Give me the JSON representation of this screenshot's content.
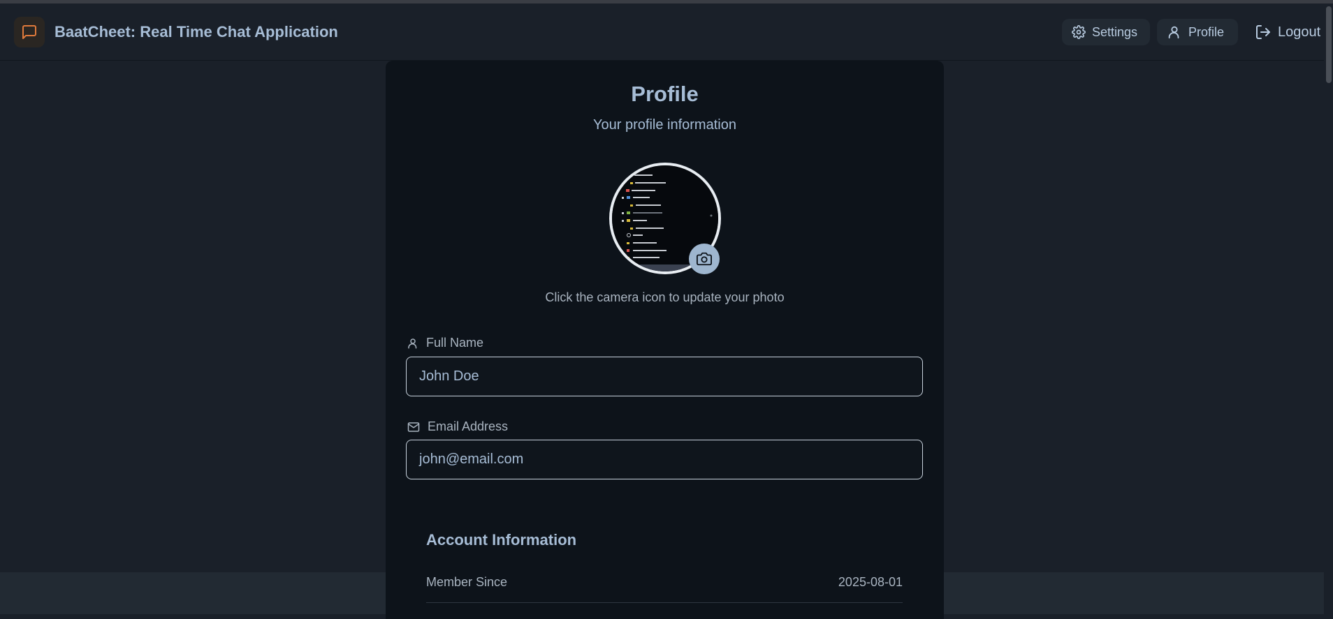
{
  "app": {
    "title": "BaatCheet: Real Time Chat Application",
    "icon": "message-square-icon",
    "accent": "#e07a3c"
  },
  "nav": {
    "settings_label": "Settings",
    "profile_label": "Profile",
    "logout_label": "Logout"
  },
  "profile": {
    "title": "Profile",
    "subtitle": "Your profile information",
    "avatar_hint": "Click the camera icon to update your photo",
    "full_name_label": "Full Name",
    "full_name_value": "John Doe",
    "email_label": "Email Address",
    "email_value": "john@email.com"
  },
  "account": {
    "title": "Account Information",
    "member_since_label": "Member Since",
    "member_since_value": "2025-08-01"
  }
}
